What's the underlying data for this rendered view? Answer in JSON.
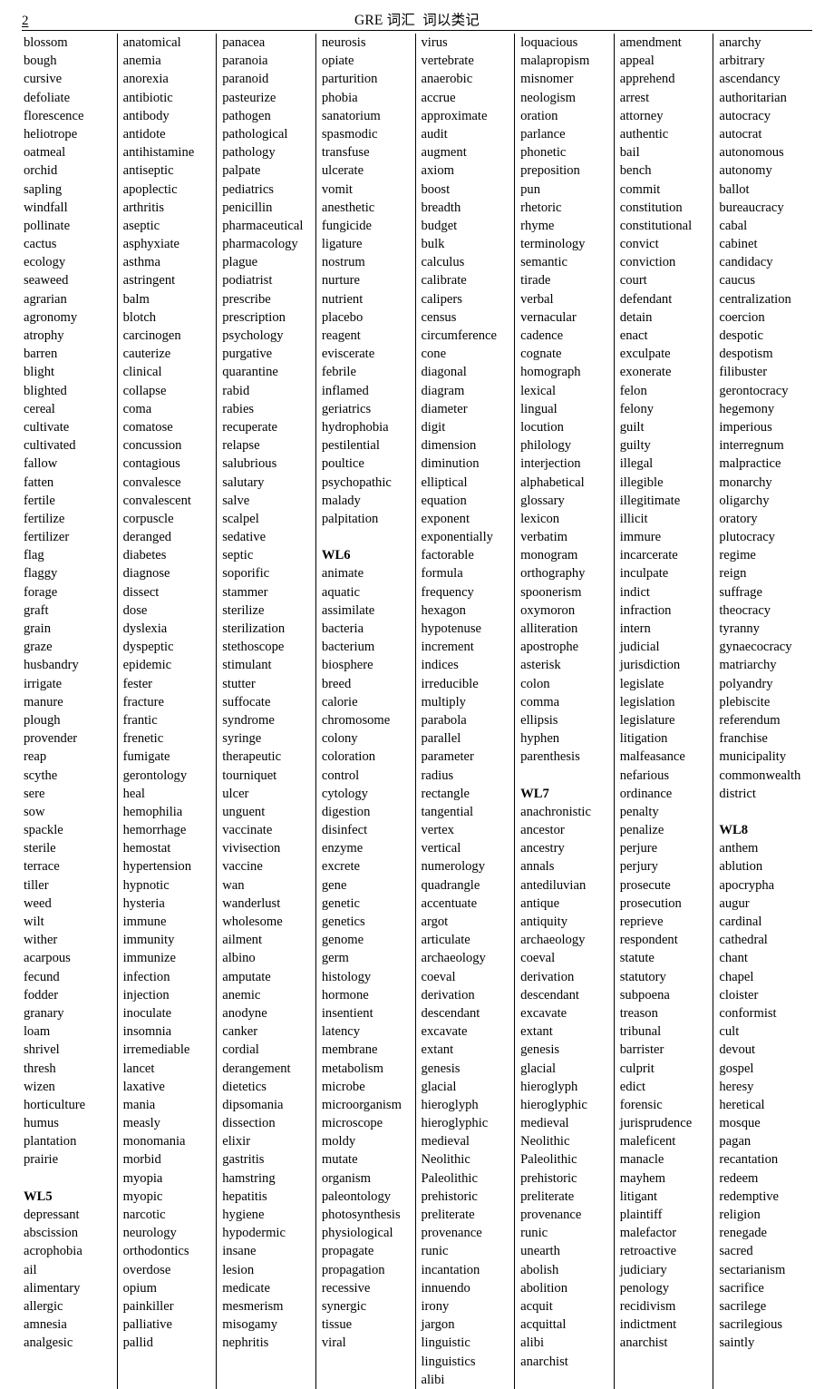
{
  "header": {
    "page_number": "2",
    "title": "GRE 词汇  词以类记"
  },
  "columns": [
    {
      "name": "column-1",
      "words": [
        "blossom",
        "bough",
        "cursive",
        "defoliate",
        "florescence",
        "heliotrope",
        "oatmeal",
        "orchid",
        "sapling",
        "windfall",
        "pollinate",
        "cactus",
        "ecology",
        "seaweed",
        "agrarian",
        "agronomy",
        "atrophy",
        "barren",
        "blight",
        "blighted",
        "cereal",
        "cultivate",
        "cultivated",
        "fallow",
        "fatten",
        "fertile",
        "fertilize",
        "fertilizer",
        "flag",
        "flaggy",
        "forage",
        "graft",
        "grain",
        "graze",
        "husbandry",
        "irrigate",
        "manure",
        "plough",
        "provender",
        "reap",
        "scythe",
        "sere",
        "sow",
        "spackle",
        "sterile",
        "terrace",
        "tiller",
        "weed",
        "wilt",
        "wither",
        "acarpous",
        "fecund",
        "fodder",
        "granary",
        "loam",
        "shrivel",
        "thresh",
        "wizen",
        "horticulture",
        "humus",
        "plantation",
        "prairie",
        "",
        "WL5",
        "depressant",
        "abscission",
        "acrophobia",
        "ail",
        "alimentary",
        "allergic",
        "amnesia",
        "analgesic"
      ],
      "bold": [
        "WL5"
      ]
    },
    {
      "name": "column-2",
      "words": [
        "anatomical",
        "anemia",
        "anorexia",
        "antibiotic",
        "antibody",
        "antidote",
        "antihistamine",
        "antiseptic",
        "apoplectic",
        "arthritis",
        "aseptic",
        "asphyxiate",
        "asthma",
        "astringent",
        "balm",
        "blotch",
        "carcinogen",
        "cauterize",
        "clinical",
        "collapse",
        "coma",
        "comatose",
        "concussion",
        "contagious",
        "convalesce",
        "convalescent",
        "corpuscle",
        "deranged",
        "diabetes",
        "diagnose",
        "dissect",
        "dose",
        "dyslexia",
        "dyspeptic",
        "epidemic",
        "fester",
        "fracture",
        "frantic",
        "frenetic",
        "fumigate",
        "gerontology",
        "heal",
        "hemophilia",
        "hemorrhage",
        "hemostat",
        "hypertension",
        "hypnotic",
        "hysteria",
        "immune",
        "immunity",
        "immunize",
        "infection",
        "injection",
        "inoculate",
        "insomnia",
        "irremediable",
        "lancet",
        "laxative",
        "mania",
        "measly",
        "monomania",
        "morbid",
        "myopia",
        "myopic",
        "narcotic",
        "neurology",
        "orthodontics",
        "overdose",
        "opium",
        "painkiller",
        "palliative",
        "pallid"
      ],
      "bold": []
    },
    {
      "name": "column-3",
      "words": [
        "panacea",
        "paranoia",
        "paranoid",
        "pasteurize",
        "pathogen",
        "pathological",
        "pathology",
        "palpate",
        "pediatrics",
        "penicillin",
        "pharmaceutical",
        "pharmacology",
        "plague",
        "podiatrist",
        "prescribe",
        "prescription",
        "psychology",
        "purgative",
        "quarantine",
        "rabid",
        "rabies",
        "recuperate",
        "relapse",
        "salubrious",
        "salutary",
        "salve",
        "scalpel",
        "sedative",
        "septic",
        "soporific",
        "stammer",
        "sterilize",
        "sterilization",
        "stethoscope",
        "stimulant",
        "stutter",
        "suffocate",
        "syndrome",
        "syringe",
        "therapeutic",
        "tourniquet",
        "ulcer",
        "unguent",
        "vaccinate",
        "vivisection",
        "vaccine",
        "wan",
        "wanderlust",
        "wholesome",
        "ailment",
        "albino",
        "amputate",
        "anemic",
        "anodyne",
        "canker",
        "cordial",
        "derangement",
        "dietetics",
        "dipsomania",
        "dissection",
        "elixir",
        "gastritis",
        "hamstring",
        "hepatitis",
        "hygiene",
        "hypodermic",
        "insane",
        "lesion",
        "medicate",
        "mesmerism",
        "misogamy",
        "nephritis"
      ],
      "bold": []
    },
    {
      "name": "column-4",
      "words": [
        "neurosis",
        "opiate",
        "parturition",
        "phobia",
        "sanatorium",
        "spasmodic",
        "transfuse",
        "ulcerate",
        "vomit",
        "anesthetic",
        "fungicide",
        "ligature",
        "nostrum",
        "nurture",
        "nutrient",
        "placebo",
        "reagent",
        "eviscerate",
        "febrile",
        "inflamed",
        "geriatrics",
        "hydrophobia",
        "pestilential",
        "poultice",
        "psychopathic",
        "malady",
        "palpitation",
        "",
        "WL6",
        "animate",
        "aquatic",
        "assimilate",
        "bacteria",
        "bacterium",
        "biosphere",
        "breed",
        "calorie",
        "chromosome",
        "colony",
        "coloration",
        "control",
        "cytology",
        "digestion",
        "disinfect",
        "enzyme",
        "excrete",
        "gene",
        "genetic",
        "genetics",
        "genome",
        "germ",
        "histology",
        "hormone",
        "insentient",
        "latency",
        "membrane",
        "metabolism",
        "microbe",
        "microorganism",
        "microscope",
        "moldy",
        "mutate",
        "organism",
        "paleontology",
        "photosynthesis",
        "physiological",
        "propagate",
        "propagation",
        "recessive",
        "synergic",
        "tissue",
        "viral"
      ],
      "bold": [
        "WL6"
      ]
    },
    {
      "name": "column-5",
      "words": [
        "virus",
        "vertebrate",
        "anaerobic",
        "accrue",
        "approximate",
        "audit",
        "augment",
        "axiom",
        "boost",
        "breadth",
        "budget",
        "bulk",
        "calculus",
        "calibrate",
        "calipers",
        "census",
        "circumference",
        "cone",
        "diagonal",
        "diagram",
        "diameter",
        "digit",
        "dimension",
        "diminution",
        "elliptical",
        "equation",
        "exponent",
        "exponentially",
        "factorable",
        "formula",
        "frequency",
        "hexagon",
        "hypotenuse",
        "increment",
        "indices",
        "irreducible",
        "multiply",
        "parabola",
        "parallel",
        "parameter",
        "radius",
        "rectangle",
        "tangential",
        "vertex",
        "vertical",
        "numerology",
        "quadrangle",
        "accentuate",
        "argot",
        "articulate",
        "archaeology",
        "coeval",
        "derivation",
        "descendant",
        "excavate",
        "extant",
        "genesis",
        "glacial",
        "hieroglyph",
        "hieroglyphic",
        "medieval",
        "Neolithic",
        "Paleolithic",
        "prehistoric",
        "preliterate",
        "provenance",
        "runic",
        "incantation",
        "innuendo",
        "irony",
        "jargon",
        "linguistic",
        "linguistics",
        "alibi"
      ],
      "bold": []
    },
    {
      "name": "column-6",
      "words": [
        "loquacious",
        "malapropism",
        "misnomer",
        "neologism",
        "oration",
        "parlance",
        "phonetic",
        "preposition",
        "pun",
        "rhetoric",
        "rhyme",
        "terminology",
        "semantic",
        "tirade",
        "verbal",
        "vernacular",
        "cadence",
        "cognate",
        "homograph",
        "lexical",
        "lingual",
        "locution",
        "philology",
        "interjection",
        "alphabetical",
        "glossary",
        "lexicon",
        "verbatim",
        "monogram",
        "orthography",
        "spoonerism",
        "oxymoron",
        "alliteration",
        "apostrophe",
        "asterisk",
        "colon",
        "comma",
        "ellipsis",
        "hyphen",
        "parenthesis",
        "",
        "WL7",
        "anachronistic",
        "ancestor",
        "ancestry",
        "annals",
        "antediluvian",
        "antique",
        "antiquity",
        "archaeology",
        "coeval",
        "derivation",
        "descendant",
        "excavate",
        "extant",
        "genesis",
        "glacial",
        "hieroglyph",
        "hieroglyphic",
        "medieval",
        "Neolithic",
        "Paleolithic",
        "prehistoric",
        "preliterate",
        "provenance",
        "runic",
        "unearth",
        "abolish",
        "abolition",
        "acquit",
        "acquittal",
        "alibi",
        "anarchist"
      ],
      "bold": [
        "WL7"
      ]
    },
    {
      "name": "column-7",
      "words": [
        "amendment",
        "appeal",
        "apprehend",
        "arrest",
        "attorney",
        "authentic",
        "bail",
        "bench",
        "commit",
        "constitution",
        "constitutional",
        "convict",
        "conviction",
        "court",
        "defendant",
        "detain",
        "enact",
        "exculpate",
        "exonerate",
        "felon",
        "felony",
        "guilt",
        "guilty",
        "illegal",
        "illegible",
        "illegitimate",
        "illicit",
        "immure",
        "incarcerate",
        "inculpate",
        "indict",
        "infraction",
        "intern",
        "judicial",
        "jurisdiction",
        "legislate",
        "legislation",
        "legislature",
        "litigation",
        "malfeasance",
        "nefarious",
        "ordinance",
        "penalty",
        "penalize",
        "perjure",
        "perjury",
        "prosecute",
        "prosecution",
        "reprieve",
        "respondent",
        "statute",
        "statutory",
        "subpoena",
        "treason",
        "tribunal",
        "barrister",
        "culprit",
        "edict",
        "forensic",
        "jurisprudence",
        "maleficent",
        "manacle",
        "mayhem",
        "litigant",
        "plaintiff",
        "malefactor",
        "retroactive",
        "judiciary",
        "penology",
        "recidivism",
        "indictment",
        "anarchist"
      ],
      "bold": []
    },
    {
      "name": "column-8",
      "words": [
        "anarchy",
        "arbitrary",
        "ascendancy",
        "authoritarian",
        "autocracy",
        "autocrat",
        "autonomous",
        "autonomy",
        "ballot",
        "bureaucracy",
        "cabal",
        "cabinet",
        "candidacy",
        "caucus",
        "centralization",
        "coercion",
        "despotic",
        "despotism",
        "filibuster",
        "gerontocracy",
        "hegemony",
        "imperious",
        "interregnum",
        "malpractice",
        "monarchy",
        "oligarchy",
        "oratory",
        "plutocracy",
        "regime",
        "reign",
        "suffrage",
        "theocracy",
        "tyranny",
        "gynaecocracy",
        "matriarchy",
        "polyandry",
        "plebiscite",
        "referendum",
        "franchise",
        "municipality",
        "commonwealth",
        "district",
        "",
        "WL8",
        "anthem",
        "ablution",
        "apocrypha",
        "augur",
        "cardinal",
        "cathedral",
        "chant",
        "chapel",
        "cloister",
        "conformist",
        "cult",
        "devout",
        "gospel",
        "heresy",
        "heretical",
        "mosque",
        "pagan",
        "recantation",
        "redeem",
        "redemptive",
        "religion",
        "renegade",
        "sacred",
        "sectarianism",
        "sacrifice",
        "sacrilege",
        "sacrilegious",
        "saintly"
      ],
      "bold": [
        "WL8"
      ]
    }
  ]
}
